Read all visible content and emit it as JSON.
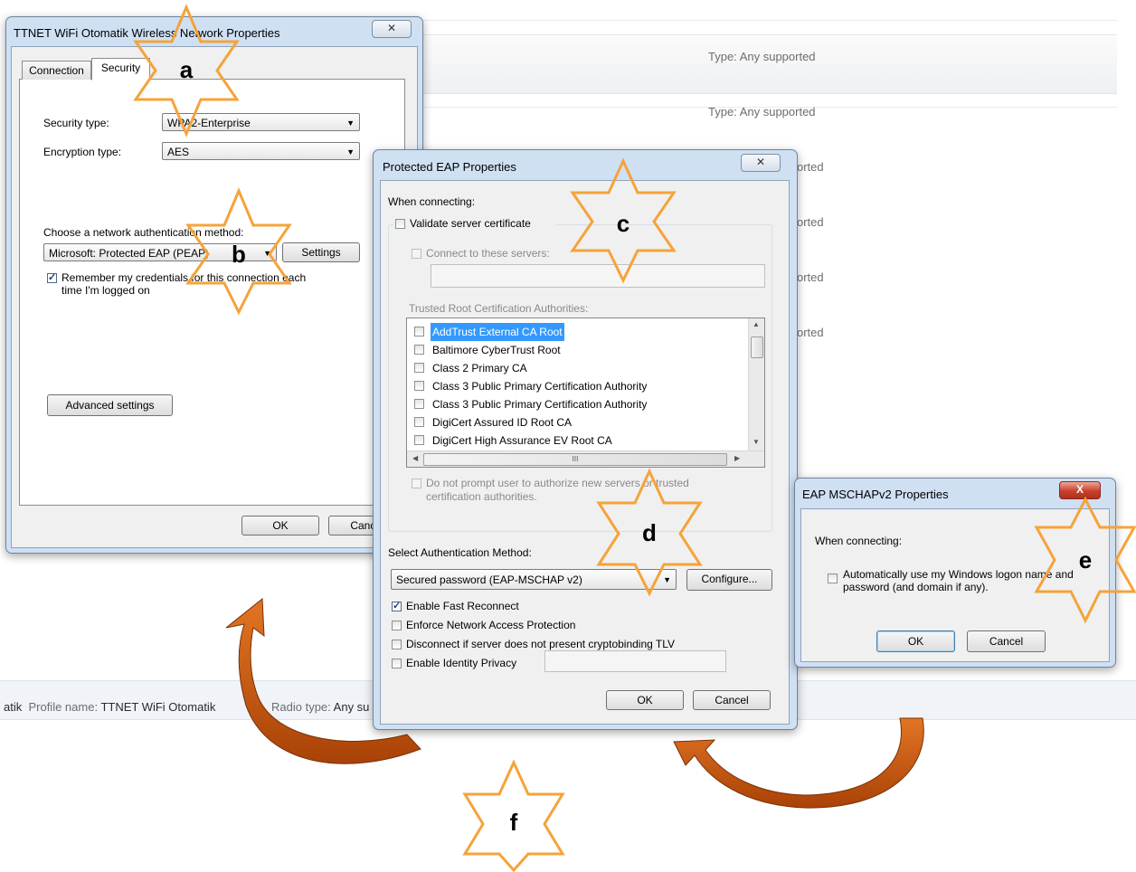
{
  "background": {
    "rows": [
      {
        "type_label": "Type:",
        "type_value": "Any supported"
      },
      {
        "type_label": "Type:",
        "type_value": "Any supported"
      },
      {
        "partial": "orted"
      },
      {
        "partial": "orted"
      },
      {
        "partial": "orted"
      },
      {
        "partial": "orted"
      }
    ],
    "footer": {
      "prefix": "atik",
      "profile_label": "Profile name:",
      "profile_value": "TTNET WiFi Otomatik",
      "radio_label": "Radio type:",
      "radio_value": "Any su"
    }
  },
  "wireless_dialog": {
    "title": "TTNET WiFi Otomatik Wireless Network Properties",
    "close_glyph": "✕",
    "tabs": [
      "Connection",
      "Security"
    ],
    "active_tab": "Security",
    "security_type_label": "Security type:",
    "security_type_value": "WPA2-Enterprise",
    "encryption_type_label": "Encryption type:",
    "encryption_type_value": "AES",
    "auth_method_label": "Choose a network authentication method:",
    "auth_method_value": "Microsoft: Protected EAP (PEAP)",
    "settings_button": "Settings",
    "remember_credentials_line1": "Remember my credentials for this connection each",
    "remember_credentials_line2": "time I'm logged on",
    "remember_credentials_checked": true,
    "advanced_settings_button": "Advanced settings",
    "ok_button": "OK",
    "cancel_button": "Cancel"
  },
  "peap_dialog": {
    "title": "Protected EAP Properties",
    "close_glyph": "✕",
    "when_connecting": "When connecting:",
    "validate_server_cert": "Validate server certificate",
    "connect_to_servers": "Connect to these servers:",
    "trusted_root_label": "Trusted Root Certification Authorities:",
    "trusted_roots": [
      {
        "name": "AddTrust External CA Root",
        "selected": true
      },
      {
        "name": "Baltimore CyberTrust Root",
        "selected": false
      },
      {
        "name": "Class 2 Primary CA",
        "selected": false
      },
      {
        "name": "Class 3 Public Primary Certification Authority",
        "selected": false
      },
      {
        "name": "Class 3 Public Primary Certification Authority",
        "selected": false
      },
      {
        "name": "DigiCert Assured ID Root CA",
        "selected": false
      },
      {
        "name": "DigiCert High Assurance EV Root CA",
        "selected": false
      }
    ],
    "hscroll_grip": "III",
    "do_not_prompt_line1": "Do not prompt user to authorize new servers or trusted",
    "do_not_prompt_line2": "certification authorities.",
    "select_auth_method_label": "Select Authentication Method:",
    "auth_method_value": "Secured password (EAP-MSCHAP v2)",
    "configure_button": "Configure...",
    "enable_fast_reconnect": "Enable Fast Reconnect",
    "enable_fast_reconnect_checked": true,
    "enforce_nap": "Enforce Network Access Protection",
    "disconnect_no_tlv": "Disconnect if server does not present cryptobinding TLV",
    "enable_identity_privacy": "Enable Identity Privacy",
    "ok_button": "OK",
    "cancel_button": "Cancel"
  },
  "mschap_dialog": {
    "title": "EAP MSCHAPv2 Properties",
    "close_glyph": "X",
    "when_connecting": "When connecting:",
    "auto_logon_line1": "Automatically use my Windows logon name and",
    "auto_logon_line2": "password (and domain if any).",
    "ok_button": "OK",
    "cancel_button": "Cancel"
  },
  "annotations": {
    "stars": [
      "a",
      "b",
      "c",
      "d",
      "e",
      "f"
    ],
    "star_color": "#f5a33a",
    "arrow_color": "#c8560e"
  }
}
